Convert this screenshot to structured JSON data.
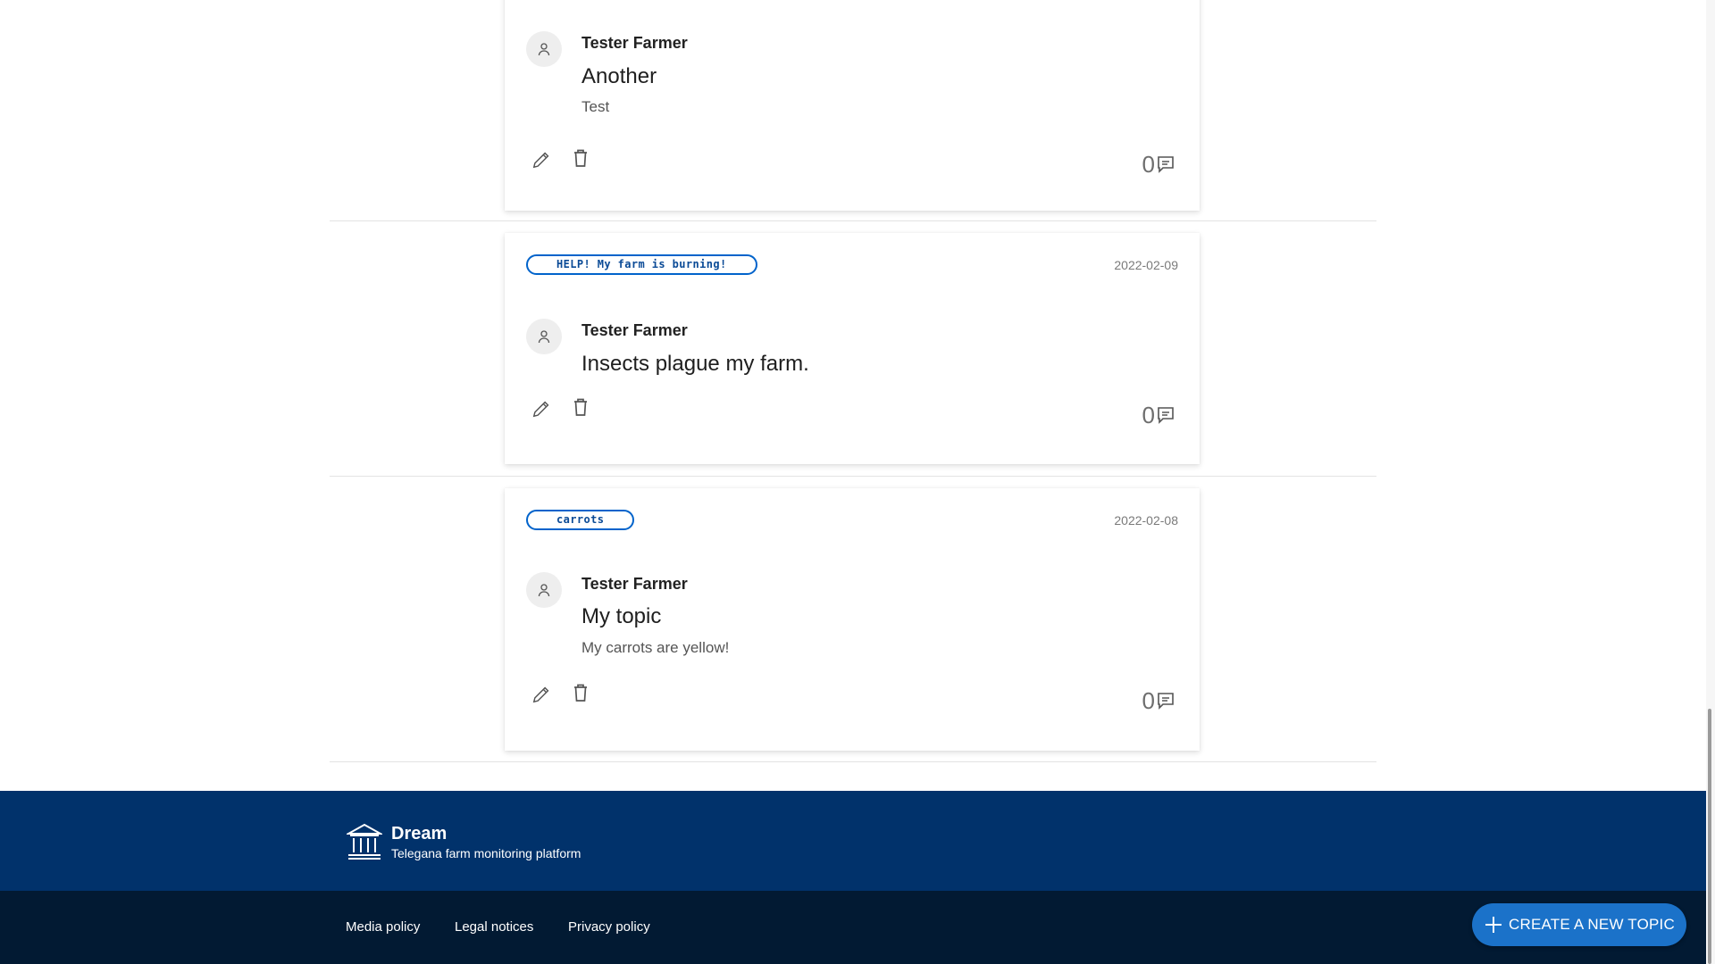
{
  "posts": [
    {
      "tag": "",
      "date": "",
      "author": "Tester Farmer",
      "title": "Another",
      "body": "Test",
      "comment_count": "0"
    },
    {
      "tag": "HELP! My farm is burning!",
      "date": "2022-02-09",
      "author": "Tester Farmer",
      "title": "Insects plague my farm.",
      "body": "",
      "comment_count": "0"
    },
    {
      "tag": "carrots",
      "date": "2022-02-08",
      "author": "Tester Farmer",
      "title": "My topic",
      "body": "My carrots are yellow!",
      "comment_count": "0"
    }
  ],
  "icons": {
    "avatar": "user-icon",
    "edit": "pencil-icon",
    "delete": "trash-icon",
    "comments": "comment-icon",
    "brand": "institution-icon",
    "fab": "plus-icon"
  },
  "footer": {
    "brand_name": "Dream",
    "brand_subtitle": "Telegana farm monitoring platform",
    "links": [
      "Media policy",
      "Legal notices",
      "Privacy policy"
    ]
  },
  "fab": {
    "label": "CREATE A NEW TOPIC"
  },
  "colors": {
    "footer_top": "#01326b",
    "footer_bottom": "#021a33",
    "tag_border": "#0063cb",
    "fab": "#1b72c9"
  }
}
